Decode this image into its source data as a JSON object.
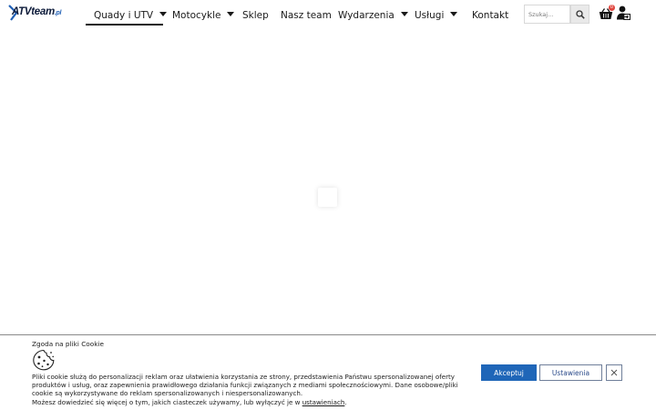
{
  "header": {
    "logo": {
      "brand": "ATVteam",
      "suffix": ".pl",
      "icon": "logo-arrow-icon"
    },
    "nav": [
      {
        "label": "Quady i UTV",
        "has_dropdown": true,
        "active": true
      },
      {
        "label": "Motocykle",
        "has_dropdown": true
      },
      {
        "label": "Sklep",
        "has_dropdown": false
      },
      {
        "label": "Nasz team",
        "has_dropdown": false
      },
      {
        "label": "Wydarzenia",
        "has_dropdown": true
      },
      {
        "label": "Usługi",
        "has_dropdown": true
      },
      {
        "label": "Kontakt",
        "has_dropdown": false
      }
    ],
    "search": {
      "placeholder": "Szukaj...",
      "icon": "search-icon"
    },
    "cart": {
      "icon": "basket-icon",
      "count": "0",
      "badge_color": "#e0463f"
    },
    "account": {
      "icon": "user-login-icon"
    }
  },
  "cookie": {
    "title": "Zgoda na pliki Cookie",
    "icon": "cookie-icon",
    "text": "Pliki cookie służą do personalizacji reklam oraz ułatwienia korzystania ze strony, przedstawienia Państwu spersonalizowanej oferty produktów i usług, oraz zapewnienia prawidłowego działania funkcji związanych z mediami społecznościowymi. Dane osobowe/pliki cookie są wykorzystywane do reklam spersonalizowanych i niespersonalizowanych.",
    "text2": "Możesz dowiedzieć się więcej o tym, jakich ciasteczek używamy, lub wyłączyć je w ",
    "link": "ustawieniach",
    "text2_end": ".",
    "accept_label": "Akceptuj",
    "settings_label": "Ustawienia",
    "close_icon": "close-icon",
    "accent_color": "#1f66b8"
  }
}
